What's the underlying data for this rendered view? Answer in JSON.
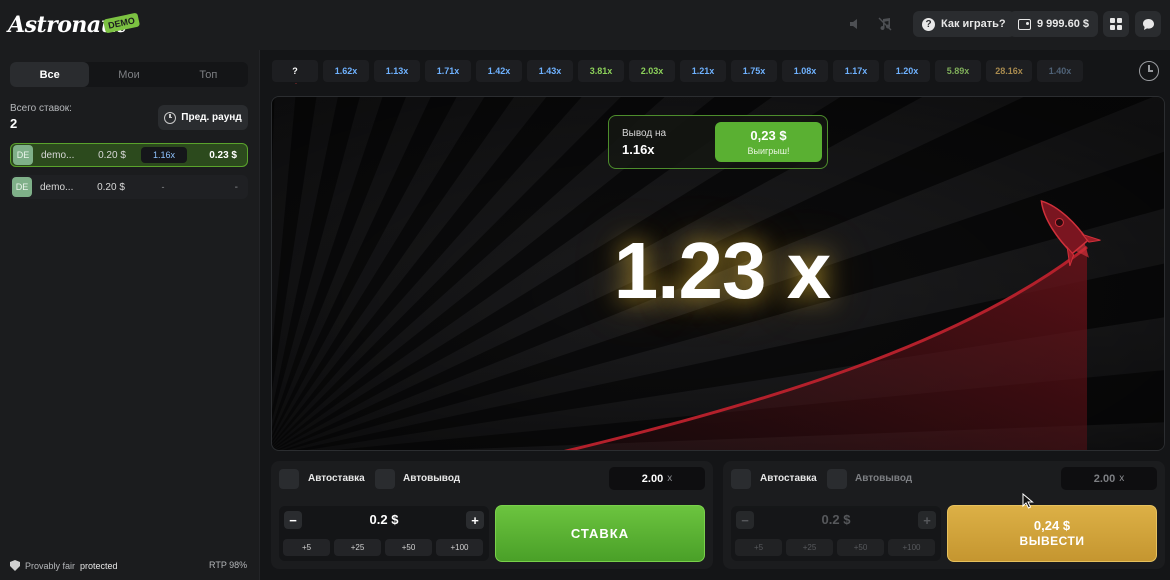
{
  "header": {
    "logo": "Astronaut",
    "logo_badge": "DEMO",
    "how_to_play": "Как играть?",
    "balance": "9 999.60 $"
  },
  "sidebar": {
    "tabs": [
      {
        "label": "Все",
        "active": true
      },
      {
        "label": "Мои",
        "active": false
      },
      {
        "label": "Топ",
        "active": false
      }
    ],
    "total_bets_label": "Всего ставок:",
    "total_bets_value": "2",
    "prev_round_label": "Пред. раунд",
    "bets": [
      {
        "avatar": "DE",
        "name": "demo...",
        "amount": "0.20 $",
        "multiplier": "1.16x",
        "win": "0.23 $"
      },
      {
        "avatar": "DE",
        "name": "demo...",
        "amount": "0.20 $",
        "multiplier": "-",
        "win": "-"
      }
    ],
    "footer": {
      "fair_prefix": "Provably fair",
      "fair_suffix": "protected",
      "rtp": "RTP 98%"
    }
  },
  "history": [
    {
      "value": "?",
      "color": "#ffffff"
    },
    {
      "value": "1.62x",
      "color": "#6fb2ff"
    },
    {
      "value": "1.13x",
      "color": "#6fb2ff"
    },
    {
      "value": "1.71x",
      "color": "#6fb2ff"
    },
    {
      "value": "1.42x",
      "color": "#6fb2ff"
    },
    {
      "value": "1.43x",
      "color": "#6fb2ff"
    },
    {
      "value": "3.81x",
      "color": "#8cd15a"
    },
    {
      "value": "2.03x",
      "color": "#8cd15a"
    },
    {
      "value": "1.21x",
      "color": "#6fb2ff"
    },
    {
      "value": "1.75x",
      "color": "#6fb2ff"
    },
    {
      "value": "1.08x",
      "color": "#6fb2ff"
    },
    {
      "value": "1.17x",
      "color": "#6fb2ff"
    },
    {
      "value": "1.20x",
      "color": "#6fb2ff"
    },
    {
      "value": "5.89x",
      "color": "#7fae5a"
    },
    {
      "value": "28.16x",
      "color": "#a88a4e"
    },
    {
      "value": "1.40x",
      "color": "#4f6277"
    }
  ],
  "game": {
    "cashout_label": "Вывод на",
    "cashout_multiplier": "1.16x",
    "cashout_amount": "0,23 $",
    "cashout_sub": "Выигрыш!",
    "multiplier": "1.23 x"
  },
  "panel_left": {
    "auto_bet": "Автоставка",
    "auto_cashout": "Автовывод",
    "auto_multiplier": "2.00",
    "auto_multiplier_suffix": "x",
    "amount": "0.2 $",
    "minus": "−",
    "plus": "+",
    "quick": [
      "+5",
      "+25",
      "+50",
      "+100"
    ],
    "action": "СТАВКА"
  },
  "panel_right": {
    "auto_bet": "Автоставка",
    "auto_cashout": "Автовывод",
    "auto_multiplier": "2.00",
    "auto_multiplier_suffix": "x",
    "amount": "0.2 $",
    "minus": "−",
    "plus": "+",
    "quick": [
      "+5",
      "+25",
      "+50",
      "+100"
    ],
    "action_amount": "0,24 $",
    "action": "ВЫВЕСТИ"
  }
}
